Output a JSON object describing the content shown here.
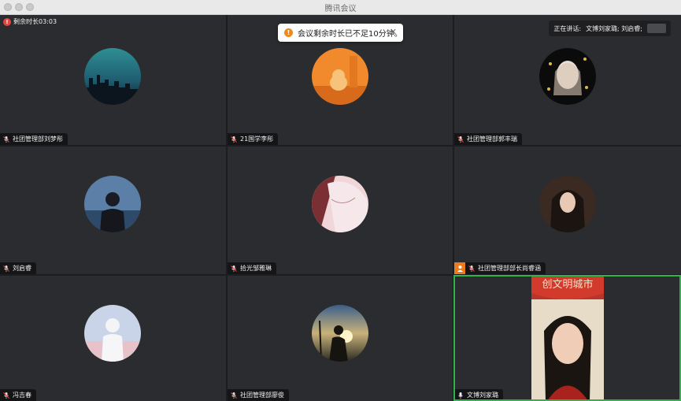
{
  "window": {
    "title": "腾讯会议"
  },
  "timer": {
    "text": "剩余时长03:03"
  },
  "toast": {
    "text": "会议剩余时长已不足10分钟。",
    "close": "✕"
  },
  "speaking": {
    "label": "正在讲话:",
    "names": "文博刘家璐; 刘启睿;"
  },
  "participants": [
    {
      "name": "社团管理部刘梦彤"
    },
    {
      "name": "21国学李彤"
    },
    {
      "name": "社团管理部郭丰瑞"
    },
    {
      "name": "刘启睿"
    },
    {
      "name": "拾光邹雅琳"
    },
    {
      "name": "社团管理部部长尚睿涵"
    },
    {
      "name": "冯吉春"
    },
    {
      "name": "社团管理部廖俊"
    },
    {
      "name": "文博刘家璐"
    }
  ],
  "video": {
    "banner_text": "创文明城市"
  },
  "colors": {
    "host_badge": "#ea7c1e",
    "active_speaker_border": "#2fb34b",
    "tile_bg": "#2b2c2f"
  }
}
